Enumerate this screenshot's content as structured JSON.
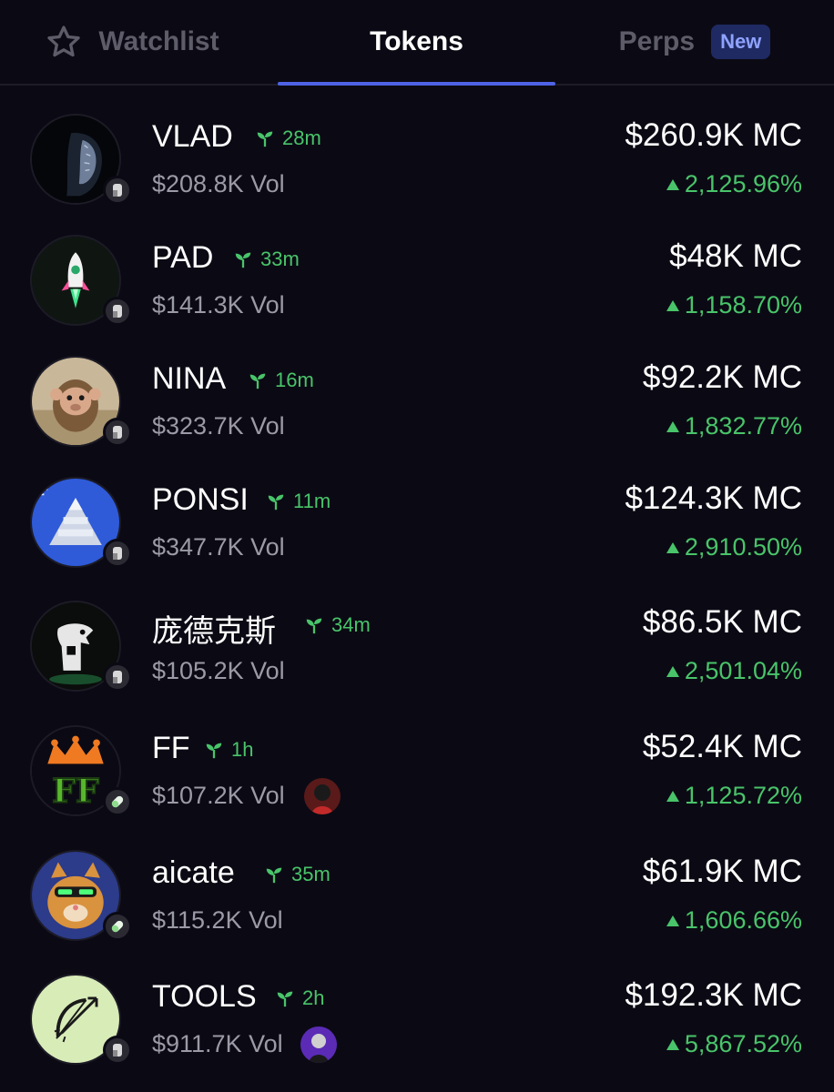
{
  "tabs": {
    "watchlist": "Watchlist",
    "tokens": "Tokens",
    "perps": "Perps",
    "new_badge": "New",
    "active": "Tokens"
  },
  "colors": {
    "background": "#0b0a14",
    "accent": "#4e63e6",
    "positive": "#49c46a",
    "muted": "#9b9aa6"
  },
  "tokens": [
    {
      "name": "VLAD",
      "age": "28m",
      "volume": "$208.8K Vol",
      "market_cap": "$260.9K MC",
      "change": "2,125.96%",
      "badge": "pump-icon"
    },
    {
      "name": "PAD",
      "age": "33m",
      "volume": "$141.3K Vol",
      "market_cap": "$48K MC",
      "change": "1,158.70%",
      "badge": "pump-icon"
    },
    {
      "name": "NINA",
      "age": "16m",
      "volume": "$323.7K Vol",
      "market_cap": "$92.2K MC",
      "change": "1,832.77%",
      "badge": "pump-icon"
    },
    {
      "name": "PONSI",
      "age": "11m",
      "volume": "$347.7K Vol",
      "market_cap": "$124.3K MC",
      "change": "2,910.50%",
      "badge": "pump-icon"
    },
    {
      "name": "庞德克斯",
      "age": "34m",
      "volume": "$105.2K Vol",
      "market_cap": "$86.5K MC",
      "change": "2,501.04%",
      "badge": "pump-icon"
    },
    {
      "name": "FF",
      "age": "1h",
      "volume": "$107.2K Vol",
      "market_cap": "$52.4K MC",
      "change": "1,125.72%",
      "badge": "pill-icon"
    },
    {
      "name": "aicate",
      "age": "35m",
      "volume": "$115.2K Vol",
      "market_cap": "$61.9K MC",
      "change": "1,606.66%",
      "badge": "pill-icon"
    },
    {
      "name": "TOOLS",
      "age": "2h",
      "volume": "$911.7K Vol",
      "market_cap": "$192.3K MC",
      "change": "5,867.52%",
      "badge": "pump-icon"
    }
  ]
}
